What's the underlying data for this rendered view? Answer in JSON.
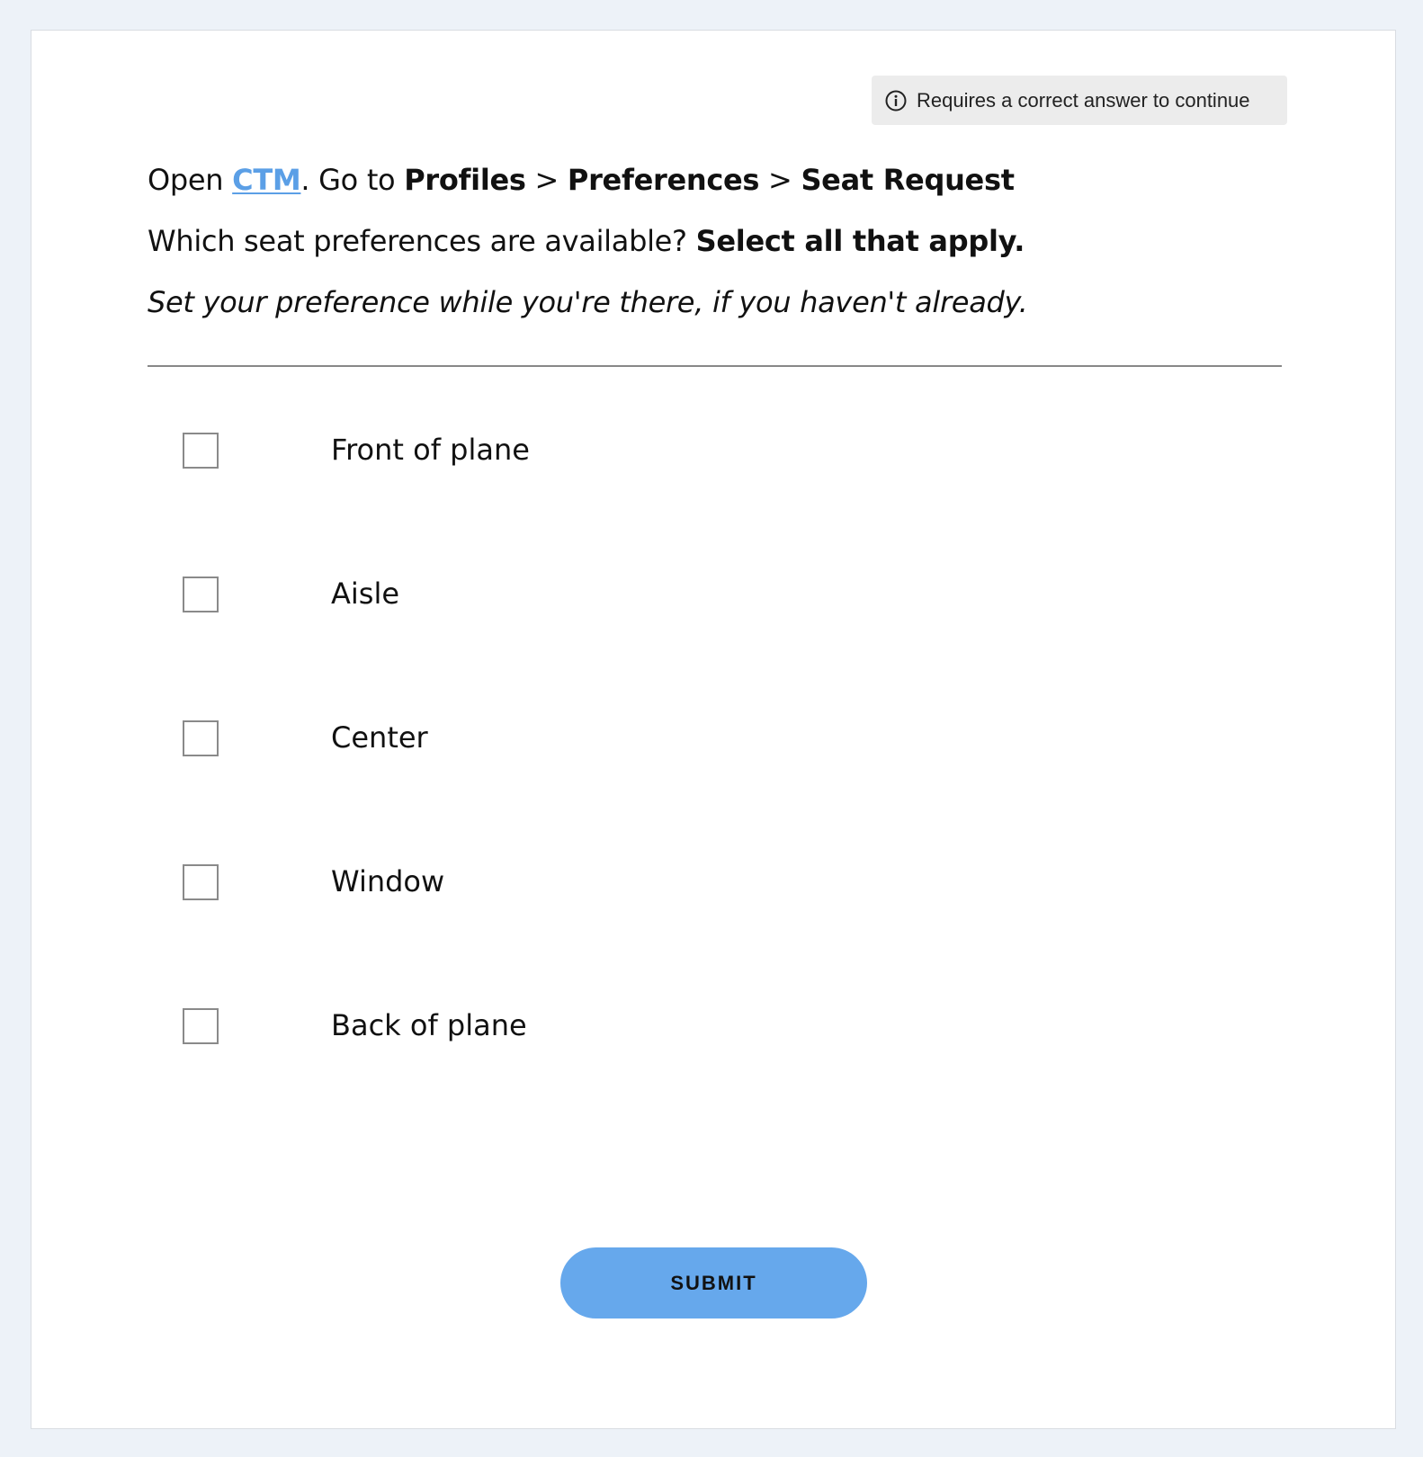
{
  "badge": {
    "icon": "info-icon",
    "text": "Requires a correct answer to continue"
  },
  "question": {
    "line1": {
      "open": "Open ",
      "link": "CTM",
      "goto": ". Go to ",
      "path1": "Profiles",
      "sep1": " > ",
      "path2": "Preferences",
      "sep2": " > ",
      "path3": "Seat Request"
    },
    "line2": {
      "text": "Which seat preferences are available? ",
      "emphasis": "Select all that apply."
    },
    "line3": "Set your preference while you're there, if you haven't already."
  },
  "options": [
    {
      "label": "Front of plane",
      "checked": false
    },
    {
      "label": "Aisle",
      "checked": false
    },
    {
      "label": "Center",
      "checked": false
    },
    {
      "label": "Window",
      "checked": false
    },
    {
      "label": "Back of plane",
      "checked": false
    }
  ],
  "submit_label": "SUBMIT",
  "colors": {
    "accent": "#66a8ec",
    "link": "#5b9fe6",
    "badge_bg": "#ececec"
  }
}
